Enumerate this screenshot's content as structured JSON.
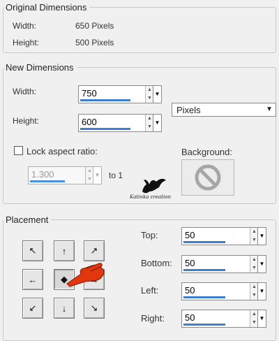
{
  "original": {
    "title": "Original Dimensions",
    "width_label": "Width:",
    "width_value": "650 Pixels",
    "height_label": "Height:",
    "height_value": "500 Pixels"
  },
  "new_dims": {
    "title": "New Dimensions",
    "width_label": "Width:",
    "width_value": "750",
    "height_label": "Height:",
    "height_value": "600",
    "units_selected": "Pixels",
    "lock_label": "Lock aspect ratio:",
    "lock_checked": false,
    "ratio_value": "1.300",
    "ratio_suffix": "to 1",
    "background_label": "Background:"
  },
  "watermark": {
    "text": "Katinka creation"
  },
  "placement": {
    "title": "Placement",
    "top_label": "Top:",
    "top_value": "50",
    "bottom_label": "Bottom:",
    "bottom_value": "50",
    "left_label": "Left:",
    "left_value": "50",
    "right_label": "Right:",
    "right_value": "50",
    "grid_icons": [
      "arrow-up-left-icon",
      "arrow-up-icon",
      "arrow-up-right-icon",
      "arrow-left-icon",
      "center-dot-icon",
      "arrow-right-icon",
      "arrow-down-left-icon",
      "arrow-down-icon",
      "arrow-down-right-icon"
    ],
    "selected": "center-dot-icon"
  },
  "colors": {
    "accent": "#3b7ed4",
    "pointer": "#e2360c",
    "panel": "#f0f0f0"
  }
}
